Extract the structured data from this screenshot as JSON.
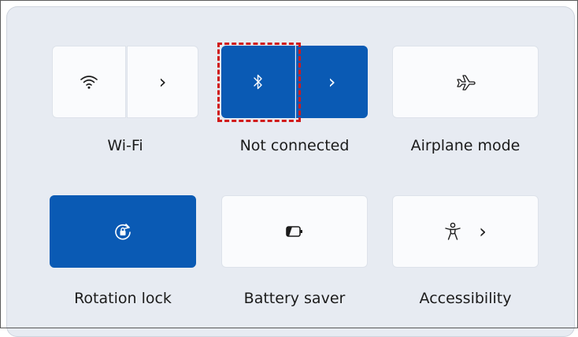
{
  "quick_settings": {
    "wifi": {
      "label": "Wi-Fi",
      "icon": "wifi-icon",
      "chevron": "›"
    },
    "bluetooth": {
      "label": "Not connected",
      "icon": "bluetooth-icon",
      "chevron": "›",
      "state": "on"
    },
    "airplane": {
      "label": "Airplane mode",
      "icon": "airplane-icon"
    },
    "rotation_lock": {
      "label": "Rotation lock",
      "icon": "rotation-lock-icon",
      "state": "on"
    },
    "battery_saver": {
      "label": "Battery saver",
      "icon": "battery-saver-icon"
    },
    "accessibility": {
      "label": "Accessibility",
      "icon": "accessibility-icon",
      "chevron": "›"
    }
  },
  "colors": {
    "panel_bg": "#e7ebf2",
    "tile_bg": "#fafbfd",
    "accent": "#0a5ab4",
    "highlight": "#d11a1a"
  }
}
